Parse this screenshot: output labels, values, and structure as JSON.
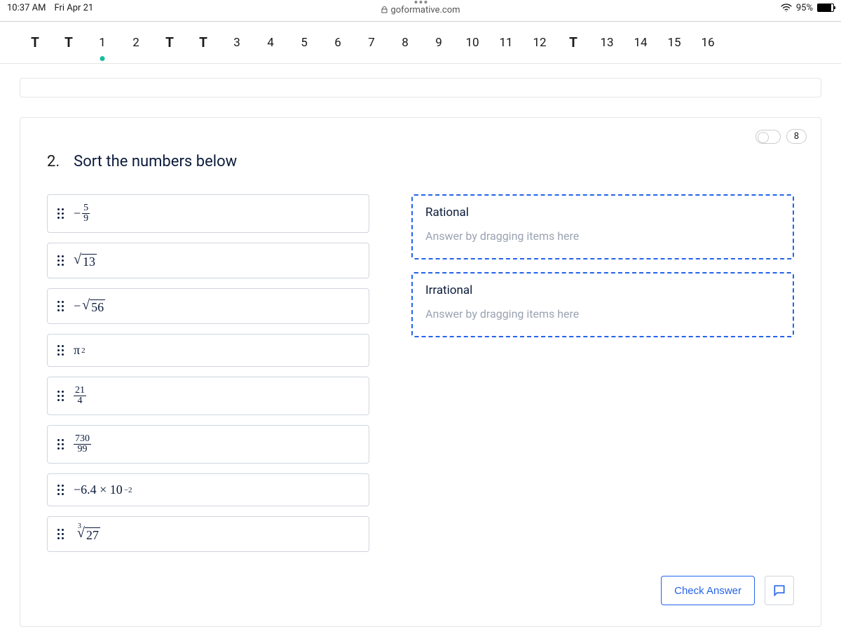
{
  "status": {
    "time": "10:37 AM",
    "date": "Fri Apr 21",
    "url": "goformative.com",
    "battery_pct": "95%"
  },
  "nav": {
    "items": [
      "T",
      "T",
      "1",
      "2",
      "T",
      "T",
      "3",
      "4",
      "5",
      "6",
      "7",
      "8",
      "9",
      "10",
      "11",
      "12",
      "T",
      "13",
      "14",
      "15",
      "16"
    ],
    "bold_indices": [
      0,
      1,
      4,
      5,
      16
    ],
    "current_index": 2
  },
  "question": {
    "points": "8",
    "number": "2.",
    "title": "Sort the numbers below",
    "items": [
      {
        "type": "neg_frac",
        "num": "5",
        "den": "9"
      },
      {
        "type": "sqrt",
        "radicand": "13"
      },
      {
        "type": "neg_sqrt",
        "radicand": "56"
      },
      {
        "type": "pi_sq"
      },
      {
        "type": "frac",
        "num": "21",
        "den": "4"
      },
      {
        "type": "frac",
        "num": "730",
        "den": "99"
      },
      {
        "type": "sci",
        "text_a": "−6.4 × 10",
        "exp": "−2"
      },
      {
        "type": "cbrt",
        "radicand": "27"
      }
    ],
    "zones": [
      {
        "title": "Rational",
        "hint": "Answer by dragging items here"
      },
      {
        "title": "Irrational",
        "hint": "Answer by dragging items here"
      }
    ],
    "check_label": "Check Answer"
  }
}
